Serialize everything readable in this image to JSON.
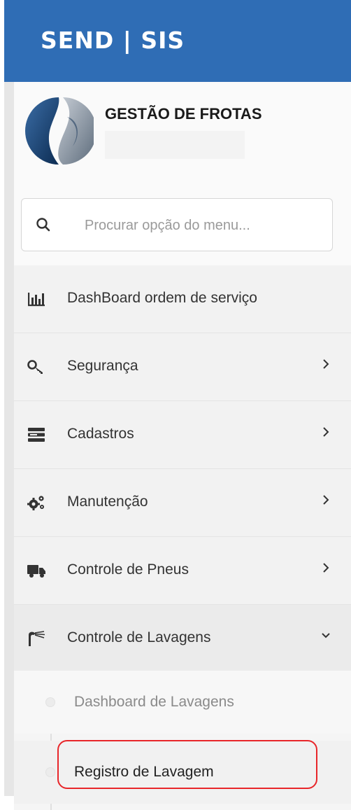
{
  "header": {
    "brand": "SEND | SIS",
    "color": "#2f6db5"
  },
  "company": {
    "name": "GESTÃO DE FROTAS"
  },
  "search": {
    "placeholder": "Procurar opção do menu..."
  },
  "menu": {
    "items": [
      {
        "label": "DashBoard ordem de serviço",
        "icon": "bar-chart-icon",
        "arrow": ""
      },
      {
        "label": "Segurança",
        "icon": "key-icon",
        "arrow": "chevron-right"
      },
      {
        "label": "Cadastros",
        "icon": "list-icon",
        "arrow": "chevron-right"
      },
      {
        "label": "Manutenção",
        "icon": "gears-icon",
        "arrow": "chevron-right"
      },
      {
        "label": "Controle de Pneus",
        "icon": "truck-icon",
        "arrow": "chevron-right"
      },
      {
        "label": "Controle de Lavagens",
        "icon": "spray-icon",
        "arrow": "chevron-down"
      }
    ],
    "submenu": [
      {
        "label": "Dashboard de Lavagens"
      },
      {
        "label": "Registro de Lavagem"
      }
    ]
  },
  "highlight_color": "#e8262a"
}
